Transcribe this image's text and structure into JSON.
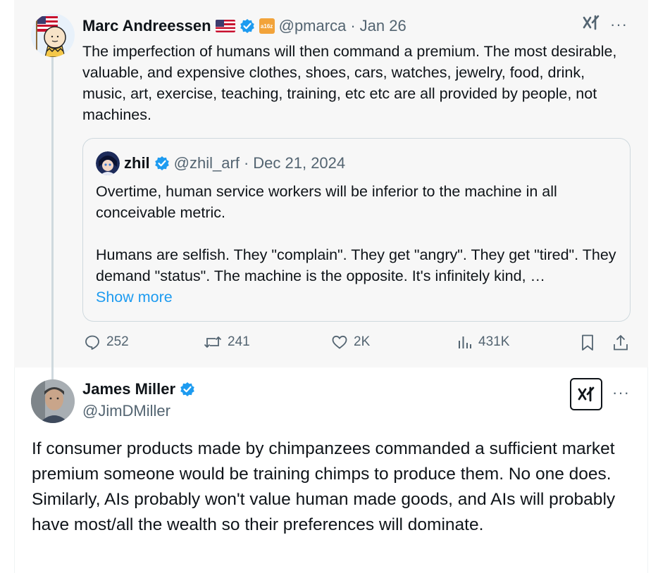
{
  "parent_tweet": {
    "author_name": "Marc Andreessen",
    "affiliate_badge": "a16z",
    "handle": "@pmarca",
    "separator": "·",
    "date": "Jan 26",
    "text": "The imperfection of humans will then command a premium. The most desirable, valuable, and expensive clothes, shoes, cars, watches, jewelry, food, drink, music, art, exercise, teaching, training, etc etc are all provided by people, not machines.",
    "more_label": "···",
    "quote": {
      "author_name": "zhil",
      "handle": "@zhil_arf",
      "separator": "·",
      "date": "Dec 21, 2024",
      "paragraph_1": "Overtime, human service workers will be inferior to the machine in all conceivable metric.",
      "paragraph_2": "Humans are selfish. They \"complain\". They get \"angry\". They get \"tired\". They demand \"status\". The machine is the opposite. It's infinitely kind, …",
      "show_more": "Show more"
    },
    "actions": {
      "replies": "252",
      "reposts": "241",
      "likes": "2K",
      "views": "431K"
    }
  },
  "reply_tweet": {
    "author_name": "James Miller",
    "handle": "@JimDMiller",
    "more_label": "···",
    "text": "If consumer products made by chimpanzees commanded a sufficient market premium someone would be training chimps to produce them. No one does. Similarly, AIs probably won't value human made goods, and AIs will probably have most/all the wealth so their preferences will dominate."
  },
  "colors": {
    "verified": "#1d9bf0",
    "link": "#1d9bf0",
    "muted_text": "#536471",
    "parent_background": "#f7f7f7"
  }
}
